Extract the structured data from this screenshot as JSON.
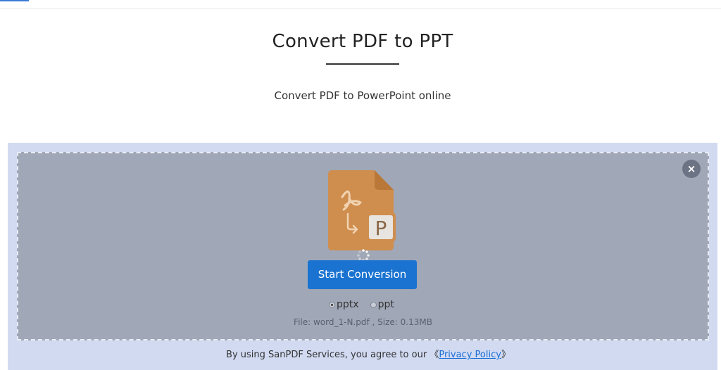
{
  "header": {
    "title": "Convert PDF to PPT",
    "subtitle": "Convert PDF to PowerPoint online"
  },
  "dropzone": {
    "close_icon": "close-icon",
    "close_glyph": "×",
    "file_icon": "pdf-to-ppt-file-icon",
    "file_icon_letter": "P",
    "start_button": "Start Conversion",
    "formats": [
      {
        "label": "pptx",
        "selected": true
      },
      {
        "label": "ppt",
        "selected": false
      }
    ],
    "file_info": "File: word_1-N.pdf , Size: 0.13MB"
  },
  "footer": {
    "agreement_prefix": "By using SanPDF Services, you agree to our ",
    "bracket_open": "《",
    "privacy_link": "Privacy Policy",
    "bracket_close": "》"
  },
  "colors": {
    "panel_background": "#d1daf1",
    "dropzone_background": "#a0a7b6",
    "button_blue": "#1a73d1",
    "file_icon_orange": "#cf8e4e",
    "link_blue": "#1a6fd6"
  }
}
